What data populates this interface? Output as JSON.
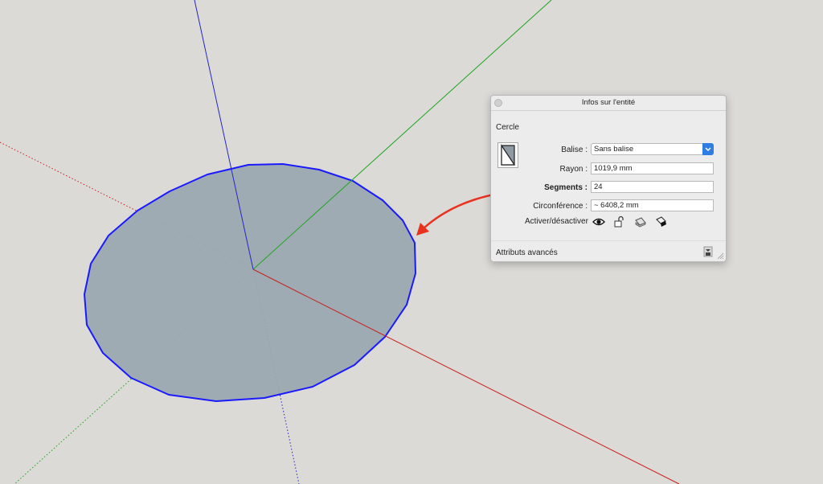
{
  "scene": {
    "colors": {
      "background": "#dcdad6",
      "circle_fill": "#9ba9b1",
      "circle_edge": "#1a1aff",
      "axis_red": "#c81e1e",
      "axis_green": "#1ea51e",
      "axis_blue": "#2525c8",
      "annotation_arrow": "#e8321e"
    },
    "circle_segments": 24
  },
  "panel": {
    "title": "Infos sur l'entité",
    "entity_type": "Cercle",
    "fields": {
      "tag_label": "Balise :",
      "tag_value": "Sans balise",
      "radius_label": "Rayon :",
      "radius_value": "1019,9 mm",
      "segments_label": "Segments :",
      "segments_value": "24",
      "circumference_label": "Circonférence :",
      "circumference_value": "~ 6408,2 mm",
      "toggle_label": "Activer/désactiver"
    },
    "toggle_icons": [
      "eye-icon",
      "lock-icon",
      "receive-shadows-icon",
      "cast-shadows-icon"
    ],
    "advanced_label": "Attributs avancés"
  }
}
